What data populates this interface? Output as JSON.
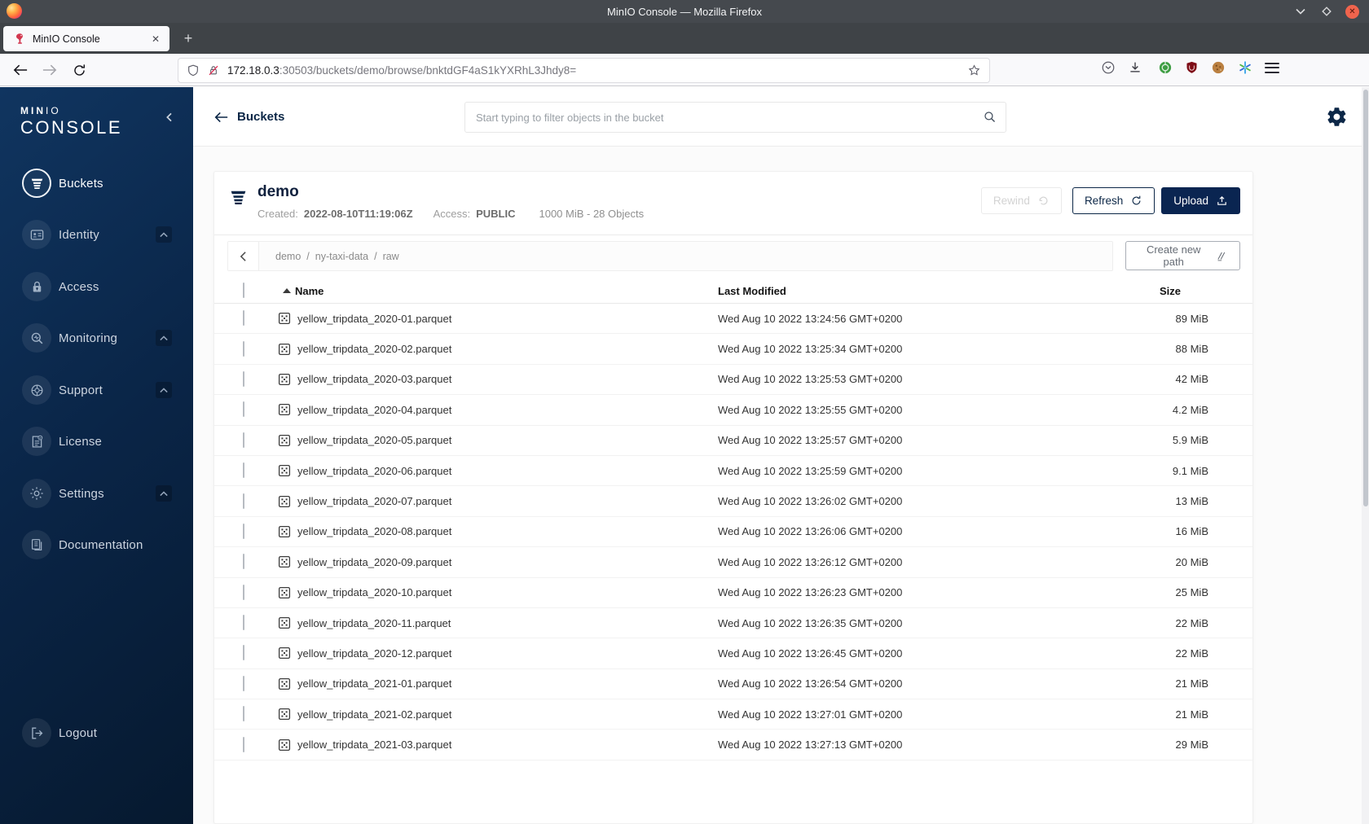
{
  "browser": {
    "window_title": "MinIO Console — Mozilla Firefox",
    "tab_title": "MinIO Console",
    "url_host": "172.18.0.3",
    "url_rest": ":30503/buckets/demo/browse/bnktdGF4aS1kYXRhL3Jhdy8="
  },
  "sidebar": {
    "logo_bold": "MIN",
    "logo_light": "IO",
    "logo_name": "CONSOLE",
    "items": [
      {
        "label": "Buckets",
        "icon": "bucket-icon",
        "active": true,
        "expandable": false
      },
      {
        "label": "Identity",
        "icon": "identity-icon",
        "active": false,
        "expandable": true
      },
      {
        "label": "Access",
        "icon": "access-icon",
        "active": false,
        "expandable": false
      },
      {
        "label": "Monitoring",
        "icon": "monitoring-icon",
        "active": false,
        "expandable": true
      },
      {
        "label": "Support",
        "icon": "support-icon",
        "active": false,
        "expandable": true
      },
      {
        "label": "License",
        "icon": "license-icon",
        "active": false,
        "expandable": false
      },
      {
        "label": "Settings",
        "icon": "settings-icon",
        "active": false,
        "expandable": true
      },
      {
        "label": "Documentation",
        "icon": "documentation-icon",
        "active": false,
        "expandable": false
      }
    ],
    "logout_label": "Logout"
  },
  "topbar": {
    "back_label": "Buckets",
    "search_placeholder": "Start typing to filter objects in the bucket"
  },
  "bucket": {
    "name": "demo",
    "created_label": "Created:",
    "created_value": "2022-08-10T11:19:06Z",
    "access_label": "Access:",
    "access_value": "PUBLIC",
    "summary": "1000 MiB - 28 Objects",
    "rewind_label": "Rewind",
    "refresh_label": "Refresh",
    "upload_label": "Upload"
  },
  "browse": {
    "breadcrumb": [
      "demo",
      "ny-taxi-data",
      "raw"
    ],
    "separator": "/",
    "create_path_label": "Create new path"
  },
  "table": {
    "columns": [
      "Name",
      "Last Modified",
      "Size"
    ],
    "sort": {
      "column": "Name",
      "direction": "asc"
    },
    "rows": [
      {
        "name": "yellow_tripdata_2020-01.parquet",
        "modified": "Wed Aug 10 2022 13:24:56 GMT+0200",
        "size": "89 MiB"
      },
      {
        "name": "yellow_tripdata_2020-02.parquet",
        "modified": "Wed Aug 10 2022 13:25:34 GMT+0200",
        "size": "88 MiB"
      },
      {
        "name": "yellow_tripdata_2020-03.parquet",
        "modified": "Wed Aug 10 2022 13:25:53 GMT+0200",
        "size": "42 MiB"
      },
      {
        "name": "yellow_tripdata_2020-04.parquet",
        "modified": "Wed Aug 10 2022 13:25:55 GMT+0200",
        "size": "4.2 MiB"
      },
      {
        "name": "yellow_tripdata_2020-05.parquet",
        "modified": "Wed Aug 10 2022 13:25:57 GMT+0200",
        "size": "5.9 MiB"
      },
      {
        "name": "yellow_tripdata_2020-06.parquet",
        "modified": "Wed Aug 10 2022 13:25:59 GMT+0200",
        "size": "9.1 MiB"
      },
      {
        "name": "yellow_tripdata_2020-07.parquet",
        "modified": "Wed Aug 10 2022 13:26:02 GMT+0200",
        "size": "13 MiB"
      },
      {
        "name": "yellow_tripdata_2020-08.parquet",
        "modified": "Wed Aug 10 2022 13:26:06 GMT+0200",
        "size": "16 MiB"
      },
      {
        "name": "yellow_tripdata_2020-09.parquet",
        "modified": "Wed Aug 10 2022 13:26:12 GMT+0200",
        "size": "20 MiB"
      },
      {
        "name": "yellow_tripdata_2020-10.parquet",
        "modified": "Wed Aug 10 2022 13:26:23 GMT+0200",
        "size": "25 MiB"
      },
      {
        "name": "yellow_tripdata_2020-11.parquet",
        "modified": "Wed Aug 10 2022 13:26:35 GMT+0200",
        "size": "22 MiB"
      },
      {
        "name": "yellow_tripdata_2020-12.parquet",
        "modified": "Wed Aug 10 2022 13:26:45 GMT+0200",
        "size": "22 MiB"
      },
      {
        "name": "yellow_tripdata_2021-01.parquet",
        "modified": "Wed Aug 10 2022 13:26:54 GMT+0200",
        "size": "21 MiB"
      },
      {
        "name": "yellow_tripdata_2021-02.parquet",
        "modified": "Wed Aug 10 2022 13:27:01 GMT+0200",
        "size": "21 MiB"
      },
      {
        "name": "yellow_tripdata_2021-03.parquet",
        "modified": "Wed Aug 10 2022 13:27:13 GMT+0200",
        "size": "29 MiB"
      }
    ]
  },
  "colors": {
    "accent_navy": "#0c2747",
    "upload_button_bg": "#0a2551",
    "sidebar_gradient_top": "#103560",
    "sidebar_gradient_bottom": "#06192f",
    "page_background": "#fbfbfb",
    "titlebar": "#45494e"
  }
}
